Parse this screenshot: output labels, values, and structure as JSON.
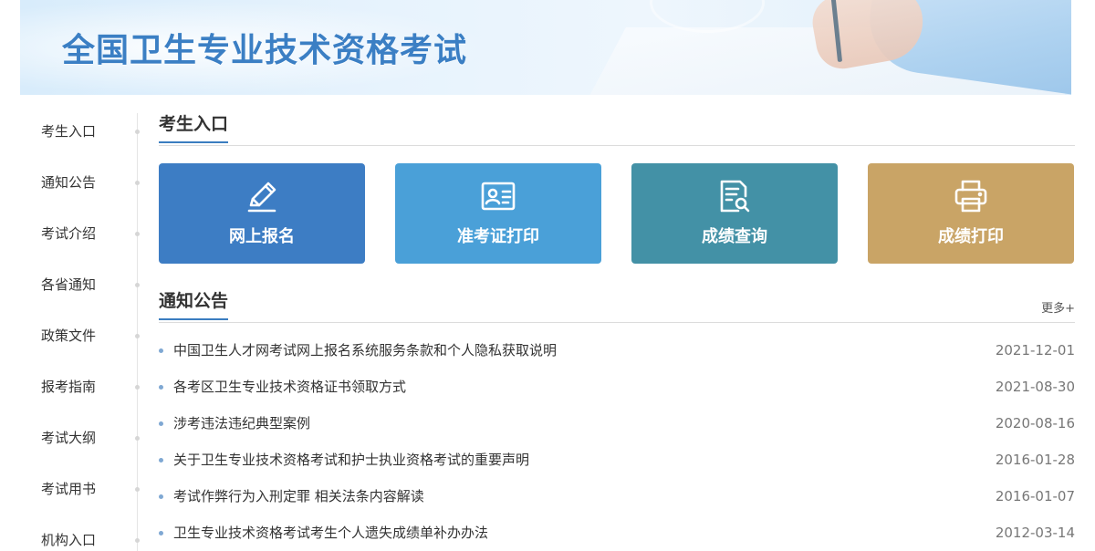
{
  "banner": {
    "title": "全国卫生专业技术资格考试"
  },
  "sidebar": {
    "items": [
      {
        "label": "考生入口"
      },
      {
        "label": "通知公告"
      },
      {
        "label": "考试介绍"
      },
      {
        "label": "各省通知"
      },
      {
        "label": "政策文件"
      },
      {
        "label": "报考指南"
      },
      {
        "label": "考试大纲"
      },
      {
        "label": "考试用书"
      },
      {
        "label": "机构入口"
      }
    ]
  },
  "entry": {
    "title": "考生入口",
    "tiles": [
      {
        "label": "网上报名",
        "icon": "pencil-icon",
        "color": "#3d7dc4"
      },
      {
        "label": "准考证打印",
        "icon": "id-card-icon",
        "color": "#4aa0d8"
      },
      {
        "label": "成绩查询",
        "icon": "document-search-icon",
        "color": "#4391a6"
      },
      {
        "label": "成绩打印",
        "icon": "printer-icon",
        "color": "#c9a466"
      }
    ]
  },
  "notices": {
    "title": "通知公告",
    "more": "更多+",
    "items": [
      {
        "text": "中国卫生人才网考试网上报名系统服务条款和个人隐私获取说明",
        "date": "2021-12-01"
      },
      {
        "text": "各考区卫生专业技术资格证书领取方式",
        "date": "2021-08-30"
      },
      {
        "text": "涉考违法违纪典型案例",
        "date": "2020-08-16"
      },
      {
        "text": "关于卫生专业技术资格考试和护士执业资格考试的重要声明",
        "date": "2016-01-28"
      },
      {
        "text": "考试作弊行为入刑定罪 相关法条内容解读",
        "date": "2016-01-07"
      },
      {
        "text": "卫生专业技术资格考试考生个人遗失成绩单补办办法",
        "date": "2012-03-14"
      }
    ]
  }
}
